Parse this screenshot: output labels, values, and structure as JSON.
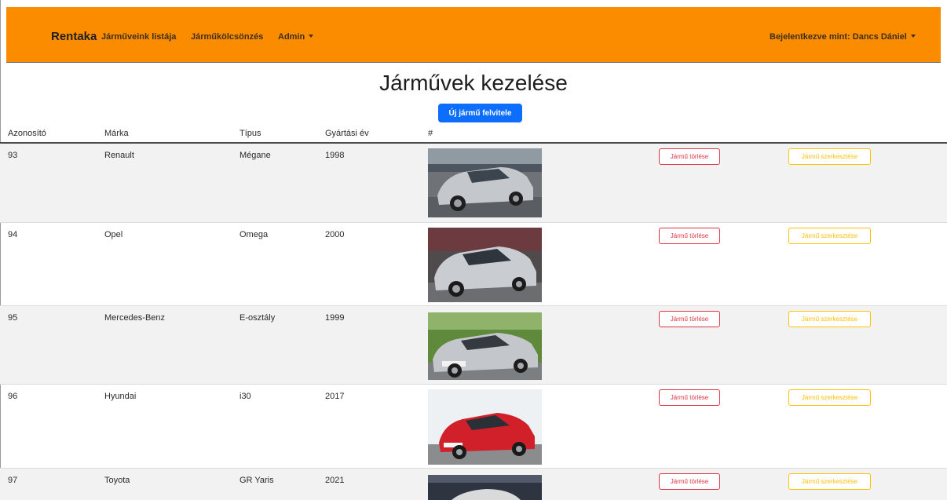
{
  "navbar": {
    "brand": "Rentaka",
    "links": [
      "Járműveink listája",
      "Járműkölcsönzés",
      "Admin"
    ],
    "user": "Bejelentkezve mint: Dancs Dániel"
  },
  "page": {
    "title": "Járművek kezelése",
    "new_button": "Új jármű felvitele"
  },
  "table": {
    "headers": [
      "Azonosító",
      "Márka",
      "Típus",
      "Gyártási év",
      "#"
    ],
    "rows": [
      {
        "id": "93",
        "brand": "Renault",
        "type": "Mégane",
        "year": "1998",
        "delete_label": "Jármű törlése",
        "edit_label": "Jármű szerkesztése"
      },
      {
        "id": "94",
        "brand": "Opel",
        "type": "Omega",
        "year": "2000",
        "delete_label": "Jármű törlése",
        "edit_label": "Jármű szerkesztése"
      },
      {
        "id": "95",
        "brand": "Mercedes-Benz",
        "type": "E-osztály",
        "year": "1999",
        "delete_label": "Jármű törlése",
        "edit_label": "Jármű szerkesztése"
      },
      {
        "id": "96",
        "brand": "Hyundai",
        "type": "i30",
        "year": "2017",
        "delete_label": "Jármű törlése",
        "edit_label": "Jármű szerkesztése"
      },
      {
        "id": "97",
        "brand": "Toyota",
        "type": "GR Yaris",
        "year": "2021",
        "delete_label": "Jármű törlése",
        "edit_label": "Jármű szerkesztése"
      }
    ]
  },
  "colors": {
    "navbar": "#fb8c00",
    "primary": "#0d6efd",
    "danger": "#dc3545",
    "warning": "#ffc107",
    "row_stripe": "#f2f2f2"
  }
}
